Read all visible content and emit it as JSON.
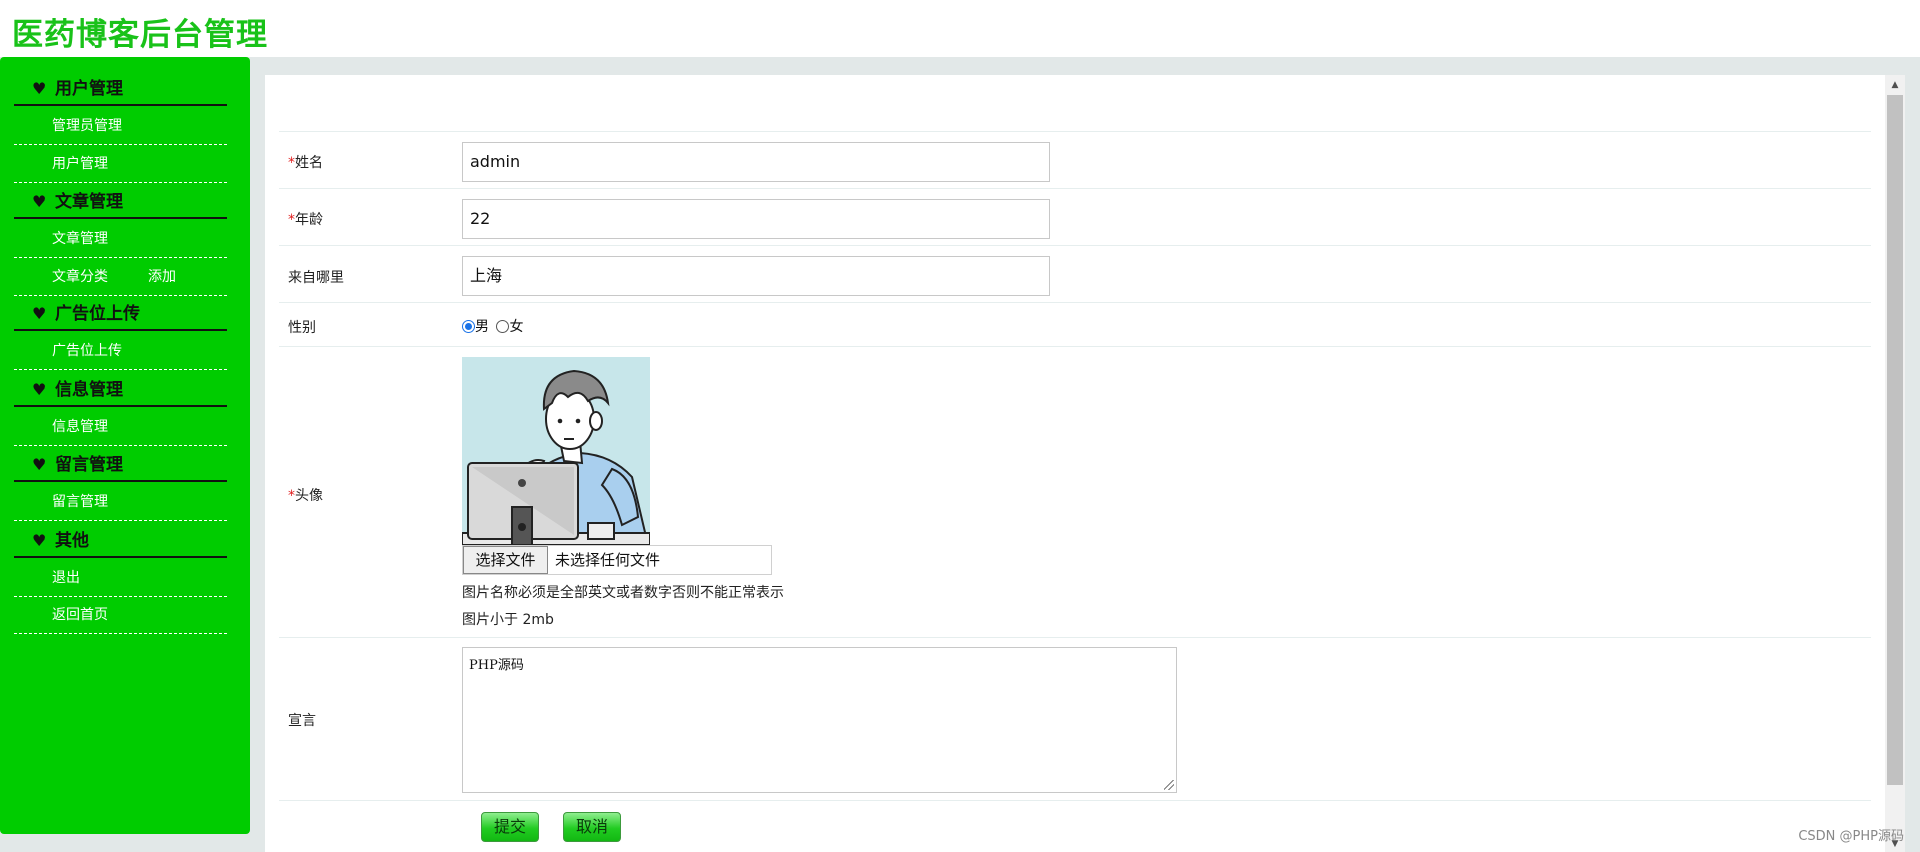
{
  "site": {
    "title": "医药博客后台管理"
  },
  "sidebar": {
    "groups": [
      {
        "title": "用户管理",
        "items": [
          {
            "label": "管理员管理"
          },
          {
            "label": "用户管理"
          }
        ]
      },
      {
        "title": "文章管理",
        "items": [
          {
            "label": "文章管理"
          },
          {
            "label": "文章分类",
            "extra": "添加"
          }
        ]
      },
      {
        "title": "广告位上传",
        "items": [
          {
            "label": "广告位上传"
          }
        ]
      },
      {
        "title": "信息管理",
        "items": [
          {
            "label": "信息管理"
          }
        ]
      },
      {
        "title": "留言管理",
        "items": [
          {
            "label": "留言管理"
          }
        ]
      },
      {
        "title": "其他",
        "items": [
          {
            "label": "退出"
          },
          {
            "label": "返回首页"
          }
        ]
      }
    ],
    "heart_glyph": "♥"
  },
  "form": {
    "required_mark": "*",
    "name": {
      "label": "姓名",
      "value": "admin"
    },
    "age": {
      "label": "年龄",
      "value": "22"
    },
    "origin": {
      "label": "来自哪里",
      "value": "上海"
    },
    "gender": {
      "label": "性别",
      "options": [
        "男",
        "女"
      ],
      "selected": "男"
    },
    "avatar": {
      "label": "头像",
      "choose_file": "选择文件",
      "file_status": "未选择任何文件",
      "hint1": "图片名称必须是全部英文或者数字否则不能正常表示",
      "hint2": "图片小于 2mb"
    },
    "motto": {
      "label": "宣言",
      "value": "PHP源码"
    },
    "submit_label": "提交",
    "cancel_label": "取消"
  },
  "watermark": "CSDN @PHP源码",
  "colors": {
    "brand_green": "#00cc00",
    "title_green": "#19c219",
    "required_red": "#e02020"
  }
}
